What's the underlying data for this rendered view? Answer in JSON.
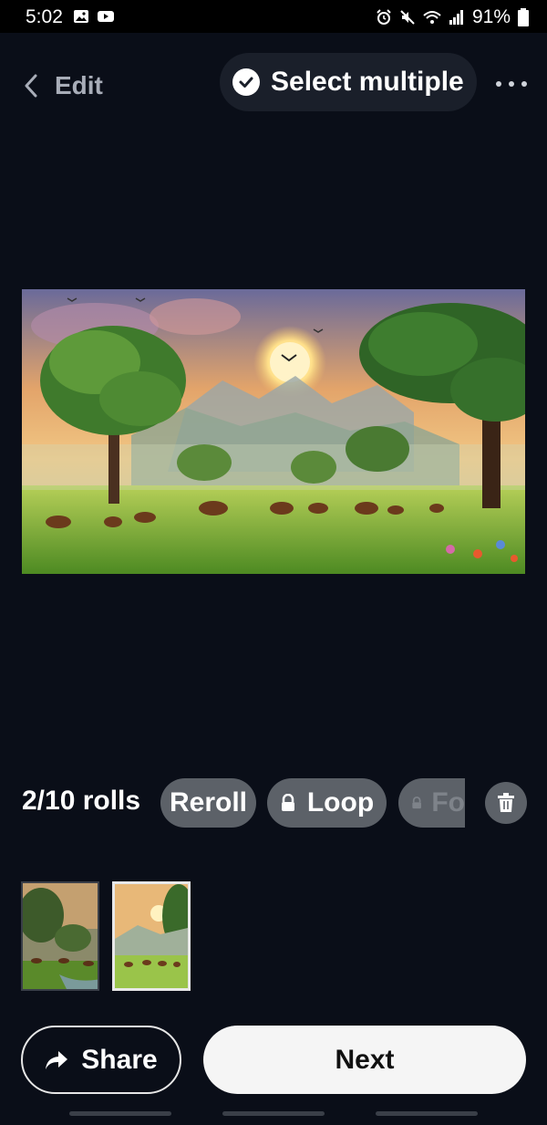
{
  "status_bar": {
    "time": "5:02",
    "battery": "91%",
    "icons": [
      "image-icon",
      "youtube-icon",
      "alarm-icon",
      "mute-icon",
      "wifi-icon",
      "signal-icon",
      "battery-icon"
    ]
  },
  "header": {
    "back_label": "Edit",
    "select_multiple_label": "Select multiple",
    "icons": [
      "chevron-left-icon",
      "check-circle-icon",
      "more-icon"
    ]
  },
  "main_image": {
    "description_icon": "generated-landscape-image"
  },
  "rolls": {
    "count_label": "2/10 rolls",
    "chips": [
      {
        "label": "Reroll",
        "locked": false
      },
      {
        "label": "Loop",
        "locked": true
      },
      {
        "label": "Fo",
        "locked": true
      }
    ]
  },
  "thumbnails": [
    {
      "selected": false
    },
    {
      "selected": true
    }
  ],
  "actions": {
    "share_label": "Share",
    "next_label": "Next"
  },
  "colors": {
    "background": "#0a0e18",
    "chip": "#5c6168",
    "next_bg": "#f5f5f5"
  }
}
